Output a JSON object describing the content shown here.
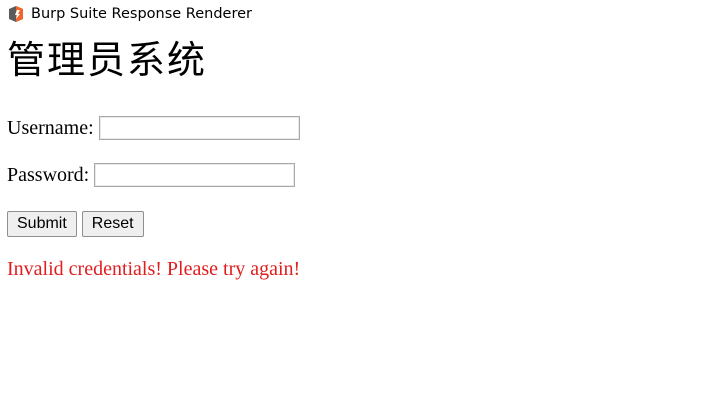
{
  "window": {
    "title": "Burp Suite Response Renderer",
    "icon": "burp-suite-icon"
  },
  "page": {
    "heading": "管理员系统",
    "username_label": "Username:",
    "username_value": "",
    "password_label": "Password:",
    "password_value": "",
    "submit_label": "Submit",
    "reset_label": "Reset",
    "error_message": "Invalid credentials! Please try again!"
  },
  "colors": {
    "error": "#e11d1d",
    "icon_orange": "#f0652b",
    "icon_dark": "#5b5b5b"
  }
}
